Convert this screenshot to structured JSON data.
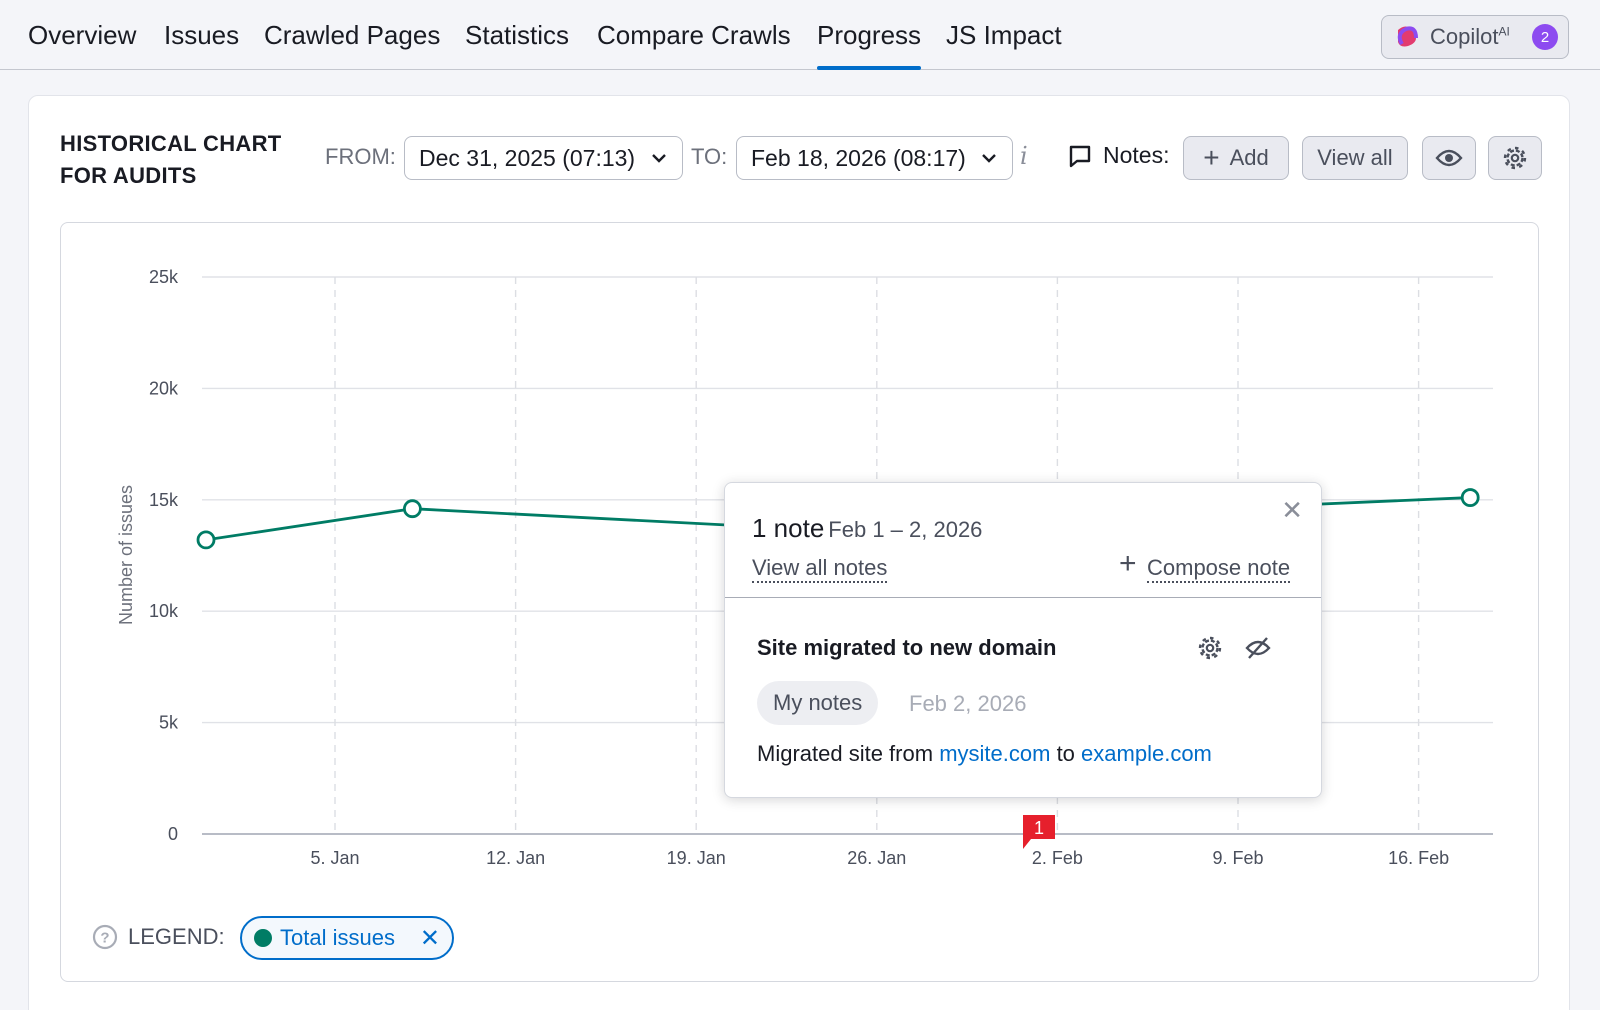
{
  "nav": {
    "tabs": [
      {
        "label": "Overview"
      },
      {
        "label": "Issues"
      },
      {
        "label": "Crawled Pages"
      },
      {
        "label": "Statistics"
      },
      {
        "label": "Compare Crawls"
      },
      {
        "label": "Progress",
        "active": true
      },
      {
        "label": "JS Impact"
      }
    ],
    "copilot": {
      "label": "Copilot",
      "sup": "AI",
      "badge": "2"
    }
  },
  "toolbar": {
    "title_line1": "HISTORICAL CHART",
    "title_line2": "FOR AUDITS",
    "from_label": "FROM:",
    "from_value": "Dec 31, 2025 (07:13)",
    "to_label": "TO:",
    "to_value": "Feb 18, 2026 (08:17)",
    "info_icon": "i",
    "notes_label": "Notes:",
    "add_label": "Add",
    "view_all_label": "View all"
  },
  "chart_data": {
    "type": "line",
    "ylabel": "Number of issues",
    "ylim": [
      0,
      25000
    ],
    "y_ticks": [
      {
        "value": 0,
        "label": "0"
      },
      {
        "value": 5000,
        "label": "5k"
      },
      {
        "value": 10000,
        "label": "10k"
      },
      {
        "value": 15000,
        "label": "15k"
      },
      {
        "value": 20000,
        "label": "20k"
      },
      {
        "value": 25000,
        "label": "25k"
      }
    ],
    "x_ticks": [
      "5. Jan",
      "12. Jan",
      "19. Jan",
      "26. Jan",
      "2. Feb",
      "9. Feb",
      "16. Feb"
    ],
    "grid": true,
    "series": [
      {
        "name": "Total issues",
        "color": "#007c65",
        "points": [
          {
            "date": "2025-12-31",
            "y": 13200
          },
          {
            "date": "2026-01-08",
            "y": 14600
          },
          {
            "date": "2026-01-23",
            "y": 13700
          },
          {
            "date": "2026-02-10",
            "y": 14700
          },
          {
            "date": "2026-02-18",
            "y": 15100
          }
        ],
        "markers": [
          "2025-12-31",
          "2026-01-08",
          "2026-02-18"
        ]
      }
    ],
    "note_flags": [
      {
        "date": "2026-02-01",
        "count": "1",
        "color": "#e6202c"
      }
    ]
  },
  "popup": {
    "count": "1 note",
    "range": "Feb 1 – 2, 2026",
    "view_all_notes": "View all notes",
    "compose_note": "Compose note",
    "note_title": "Site migrated to new domain",
    "note_tag": "My notes",
    "note_date": "Feb 2, 2026",
    "body_prefix": "Migrated site from",
    "body_link1": "mysite.com",
    "body_mid": "to",
    "body_link2": "example.com"
  },
  "legend": {
    "label": "LEGEND:",
    "chip_label": "Total issues"
  },
  "colors": {
    "accent": "#006dca",
    "series": "#007c65",
    "flag": "#e6202c"
  }
}
